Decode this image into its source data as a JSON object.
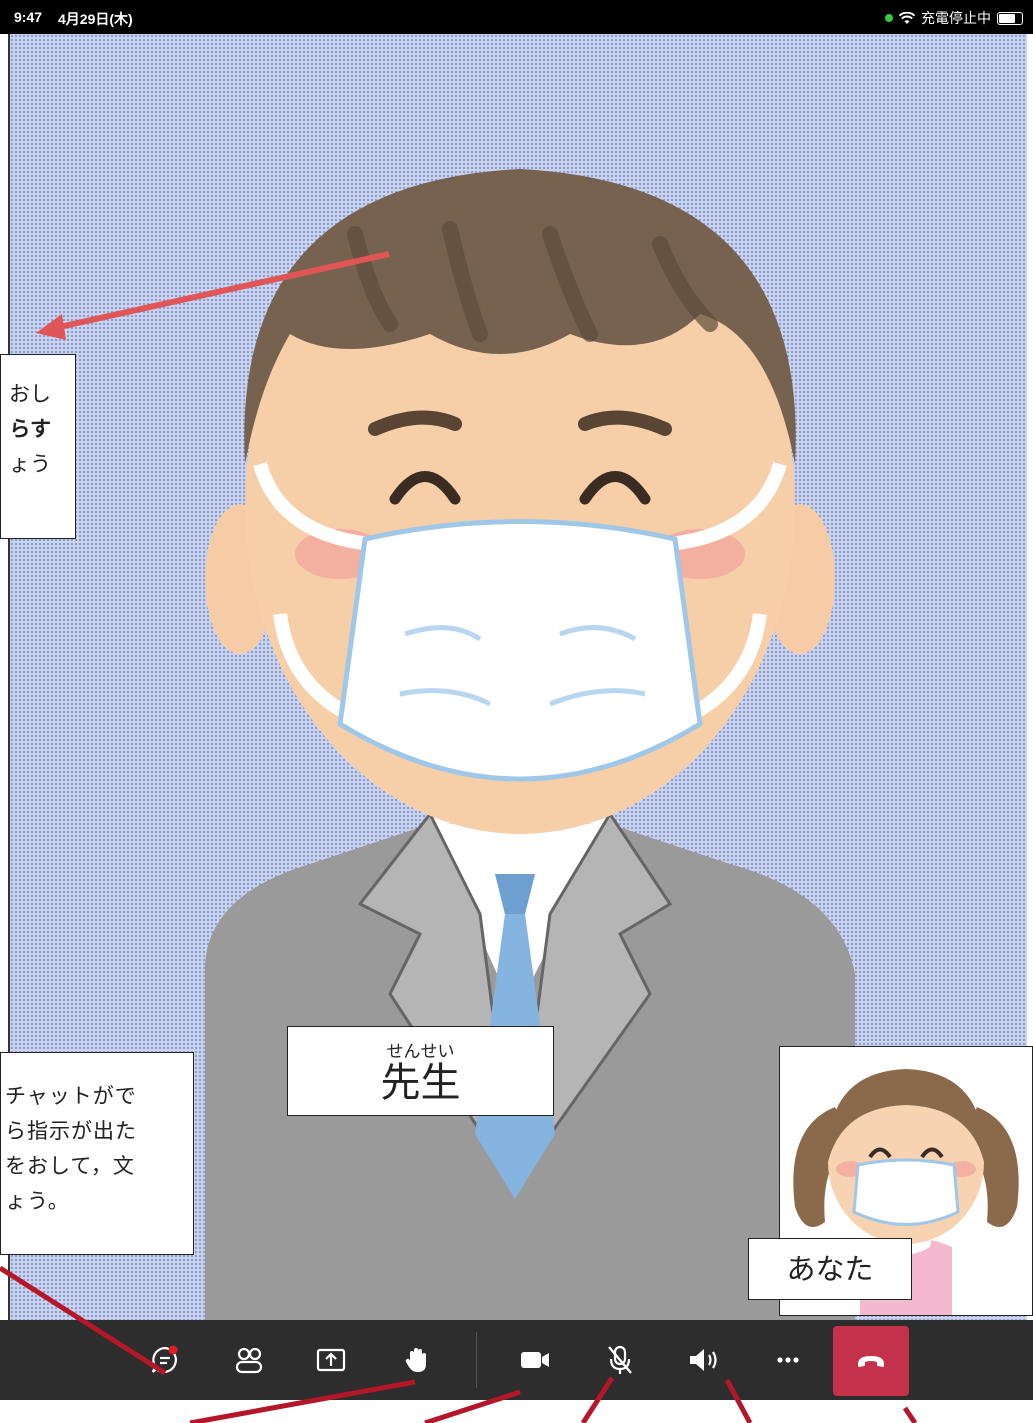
{
  "status_bar": {
    "time": "9:47",
    "date": "4月29日(木)",
    "charging_status": "充電停止中",
    "indicator_color": "#2ecc40"
  },
  "main_video": {
    "name_ruby": "せんせい",
    "name": "先生"
  },
  "self_view": {
    "label": "あなた"
  },
  "callout_top": {
    "lines": [
      "おし",
      "らす",
      "ょう"
    ]
  },
  "callout_bottom": {
    "lines": [
      "チャットがで",
      "ら指示が出た",
      "をおして，文",
      "ょう。"
    ]
  },
  "toolbar": {
    "buttons": [
      {
        "icon": "chat-icon",
        "has_notification": true
      },
      {
        "icon": "participants-icon"
      },
      {
        "icon": "share-screen-icon"
      },
      {
        "icon": "raise-hand-icon"
      },
      {
        "icon": "camera-icon"
      },
      {
        "icon": "mic-off-icon"
      },
      {
        "icon": "speaker-icon"
      },
      {
        "icon": "more-icon"
      },
      {
        "icon": "hang-up-icon"
      }
    ],
    "hangup_color": "#c4314b",
    "notification_color": "#e02020"
  },
  "colors": {
    "arrow": "#e05555",
    "pointer_line": "#b5162a"
  }
}
